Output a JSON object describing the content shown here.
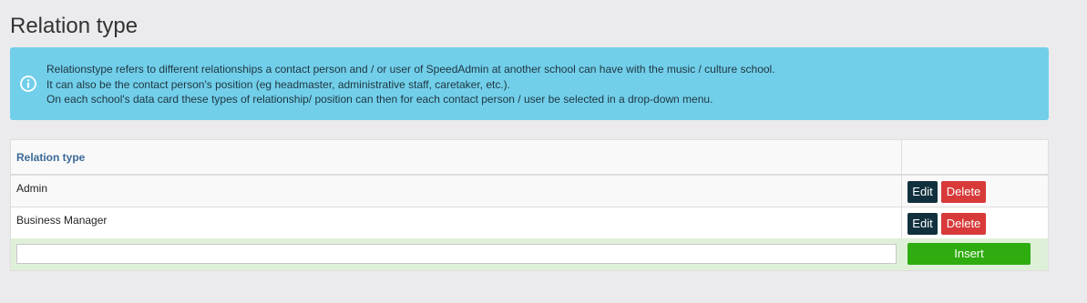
{
  "page": {
    "title": "Relation type"
  },
  "info": {
    "icon": "info-circle-icon",
    "lines": [
      "Relationstype refers to different relationships a contact person and / or user of SpeedAdmin at another school can have with the music / culture school.",
      "It can also be the contact person's position (eg headmaster, administrative staff, caretaker, etc.).",
      "On each school's data card these types of relationship/ position can then for each contact person / user be selected in a drop-down menu."
    ],
    "background": "#72cfea"
  },
  "table": {
    "columns": [
      "Relation type",
      ""
    ],
    "rows": [
      {
        "name": "Admin",
        "edit_label": "Edit",
        "delete_label": "Delete"
      },
      {
        "name": "Business Manager",
        "edit_label": "Edit",
        "delete_label": "Delete"
      }
    ],
    "new_value": "",
    "insert_label": "Insert"
  },
  "colors": {
    "edit": "#11303d",
    "delete": "#d83a3a",
    "insert": "#2fac10",
    "header_text": "#3b6a96"
  }
}
